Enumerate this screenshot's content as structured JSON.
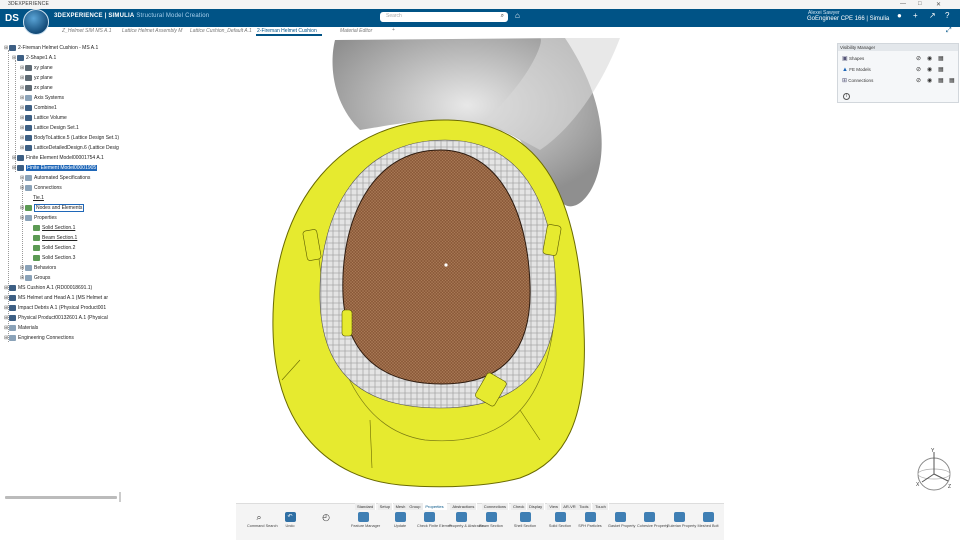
{
  "app": {
    "corner_title": "3DEXPERIENCE",
    "brand_strong": "3DEXPERIENCE | SIMULIA",
    "brand_sub": "Structural Model Creation",
    "logo": "DS"
  },
  "search": {
    "placeholder": "Search"
  },
  "user": {
    "name": "Alexei Sawyer",
    "tenant": "GoEngineer CPE 166 | Simulia"
  },
  "tabs": [
    {
      "label": "Z_Helmet SIM MS A.1"
    },
    {
      "label": "Lattice Helmet Assembly M"
    },
    {
      "label": "Lattice Cushion_Default A.1"
    },
    {
      "label": "2-Fireman Helmet Cushion"
    },
    {
      "label": "Material Editor"
    },
    {
      "label": "+"
    }
  ],
  "tree": [
    {
      "label": "2-Fireman Helmet Cushion - MS A.1",
      "level": 0,
      "icon": "part"
    },
    {
      "label": "2-Shape1 A.1",
      "level": 1,
      "icon": "part"
    },
    {
      "label": "xy plane",
      "level": 2,
      "icon": "plane"
    },
    {
      "label": "yz plane",
      "level": 2,
      "icon": "plane"
    },
    {
      "label": "zx plane",
      "level": 2,
      "icon": "plane"
    },
    {
      "label": "Axis Systems",
      "level": 2,
      "icon": "axis"
    },
    {
      "label": "Combine1",
      "level": 2,
      "icon": "part"
    },
    {
      "label": "Lattice Volume",
      "level": 2,
      "icon": "part"
    },
    {
      "label": "Lattice Design Set.1",
      "level": 2,
      "icon": "part"
    },
    {
      "label": "BodyToLattice.5 (Lattice Design Set.1)",
      "level": 2,
      "icon": "part"
    },
    {
      "label": "LatticeDetailedDesign.6 (Lattice Desig",
      "level": 2,
      "icon": "part"
    },
    {
      "label": "Finite Element Model00001754 A.1",
      "level": 1,
      "icon": "part"
    },
    {
      "label": "Finite Element Model00001905",
      "level": 1,
      "icon": "part",
      "selected": true
    },
    {
      "label": "Automated Specifications",
      "level": 2,
      "icon": "axis"
    },
    {
      "label": "Connections",
      "level": 2,
      "icon": "axis"
    },
    {
      "label": "Tie.1",
      "level": 3,
      "icon": "none",
      "underline": true
    },
    {
      "label": "Nodes and Elements",
      "level": 2,
      "icon": "green",
      "boxed": true
    },
    {
      "label": "Properties",
      "level": 2,
      "icon": "axis"
    },
    {
      "label": "Solid Section.1",
      "level": 3,
      "icon": "green",
      "underline": true
    },
    {
      "label": "Beam Section.1",
      "level": 3,
      "icon": "green",
      "underline": true
    },
    {
      "label": "Solid Section.2",
      "level": 3,
      "icon": "green"
    },
    {
      "label": "Solid Section.3",
      "level": 3,
      "icon": "green"
    },
    {
      "label": "Behaviors",
      "level": 2,
      "icon": "axis"
    },
    {
      "label": "Groups",
      "level": 2,
      "icon": "axis"
    },
    {
      "label": "MS Cushion A.1 (RD00018691.1)",
      "level": 0,
      "icon": "part"
    },
    {
      "label": "MS Helmet and Head A.1 (MS Helmet ar",
      "level": 0,
      "icon": "part"
    },
    {
      "label": "Impact Debris A.1 (Physical Product001",
      "level": 0,
      "icon": "part"
    },
    {
      "label": "Physical Product00132601 A.1 (Physical",
      "level": 0,
      "icon": "part"
    },
    {
      "label": "Materials",
      "level": 0,
      "icon": "axis"
    },
    {
      "label": "Engineering Connections",
      "level": 0,
      "icon": "axis"
    }
  ],
  "visibility_manager": {
    "title": "Visibility Manager",
    "rows": [
      {
        "label": "Shapes"
      },
      {
        "label": "FE Models"
      },
      {
        "label": "Connections"
      }
    ]
  },
  "toolbar": {
    "tabs": [
      "Standard",
      "Setup",
      "Mesh",
      "Group",
      "Properties",
      "Abstractions",
      "Connections",
      "Check",
      "Display",
      "View",
      "AR-VR",
      "Tools",
      "Touch"
    ],
    "active_tab": "Properties",
    "tools": [
      {
        "label": "Command Search",
        "icon": "search-icon"
      },
      {
        "label": "Undo",
        "icon": "undo-icon"
      },
      {
        "label": "",
        "icon": "clock-icon"
      },
      {
        "label": "Feature Manager",
        "icon": "tree-icon"
      },
      {
        "label": "Update",
        "icon": "update-icon"
      },
      {
        "label": "Check Finite Elemen..",
        "icon": "check-icon"
      },
      {
        "label": "Property & Abstracto..",
        "icon": "property-icon"
      },
      {
        "label": "Beam Section",
        "icon": "beam-icon"
      },
      {
        "label": "Shell Section",
        "icon": "shell-icon"
      },
      {
        "label": "Solid Section",
        "icon": "solid-icon"
      },
      {
        "label": "SPH Particles",
        "icon": "sph-icon"
      },
      {
        "label": "Gasket Property",
        "icon": "gasket-icon"
      },
      {
        "label": "Cohesive Property",
        "icon": "cohesive-icon"
      },
      {
        "label": "Eulerian Property",
        "icon": "eulerian-icon"
      },
      {
        "label": "Meshed Bolt",
        "icon": "bolt-icon"
      }
    ]
  },
  "axes": {
    "x": "X",
    "y": "Y",
    "z": "Z"
  },
  "colors": {
    "topbar": "#005386",
    "helmet": "#e9ed33",
    "lattice": "#8a5a3a",
    "selection": "#1f67b8"
  }
}
